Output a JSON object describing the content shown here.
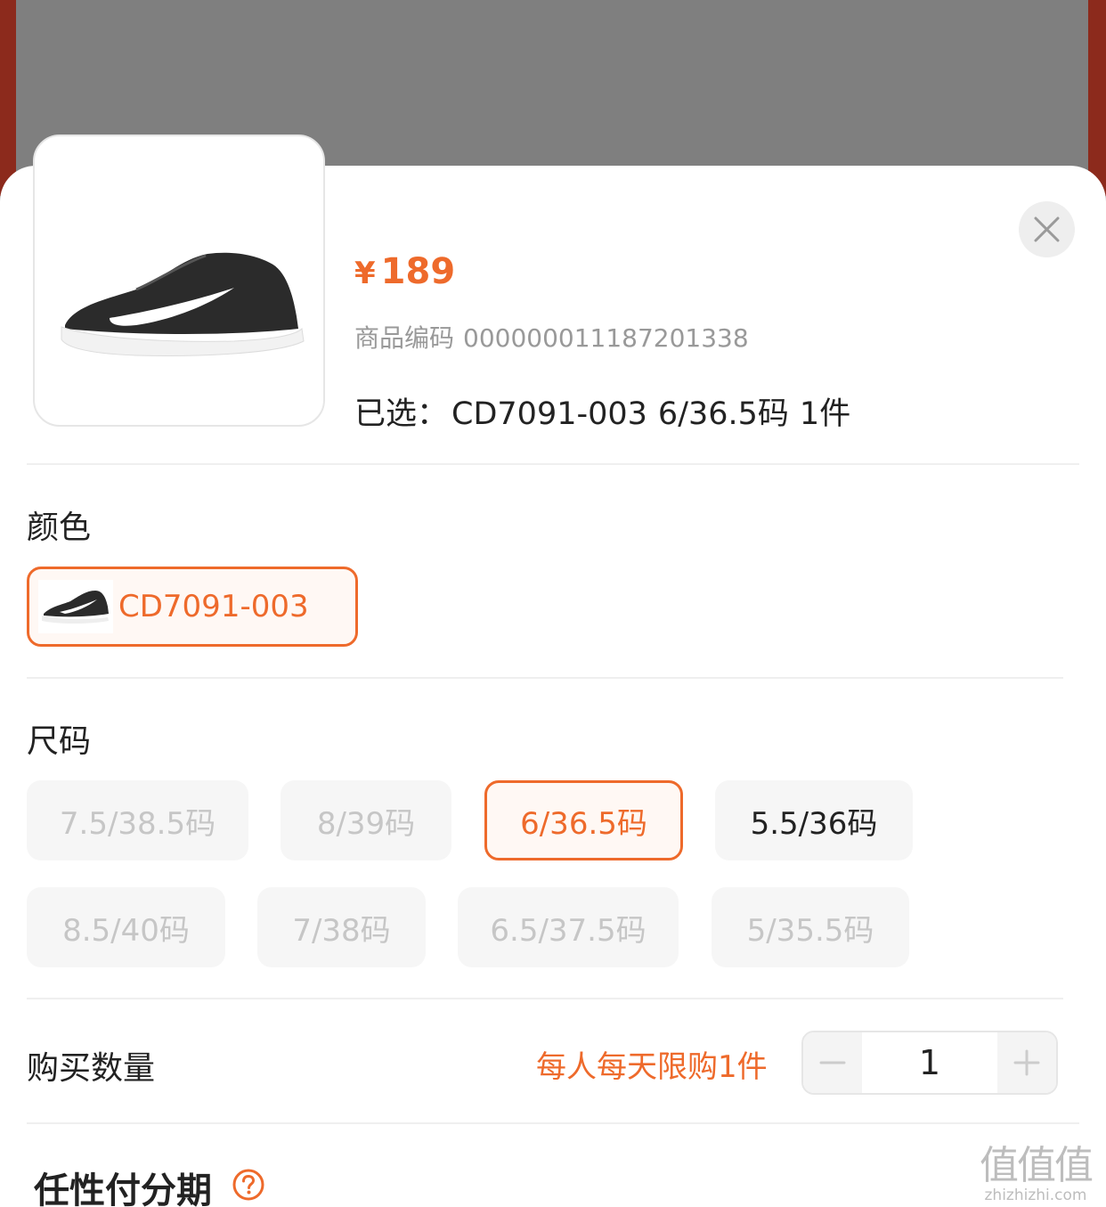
{
  "product": {
    "currency": "¥",
    "price": "189",
    "code_label": "商品编码",
    "code_value": "000000011187201338",
    "selected_label": "已选：",
    "selected_color": "CD7091-003",
    "selected_size": "6/36.5码",
    "selected_qty": "1件"
  },
  "color_section": {
    "title": "颜色",
    "options": [
      {
        "label": "CD7091-003",
        "selected": true
      }
    ]
  },
  "size_section": {
    "title": "尺码",
    "options": [
      {
        "label": "7.5/38.5码",
        "state": "disabled"
      },
      {
        "label": "8/39码",
        "state": "disabled"
      },
      {
        "label": "6/36.5码",
        "state": "selected"
      },
      {
        "label": "5.5/36码",
        "state": "available"
      },
      {
        "label": "8.5/40码",
        "state": "disabled"
      },
      {
        "label": "7/38码",
        "state": "disabled"
      },
      {
        "label": "6.5/37.5码",
        "state": "disabled"
      },
      {
        "label": "5/35.5码",
        "state": "disabled"
      }
    ]
  },
  "quantity_section": {
    "title": "购买数量",
    "limit_note": "每人每天限购1件",
    "value": "1"
  },
  "installment": {
    "title": "任性付分期"
  },
  "watermark": {
    "glyphs": "值值值",
    "url": "zhizhizhi.com"
  },
  "colors": {
    "accent": "#ee6a2b",
    "overlay": "#7f7f7f",
    "disabled_text": "#c6c6c6",
    "disabled_bg": "#f6f6f6"
  }
}
